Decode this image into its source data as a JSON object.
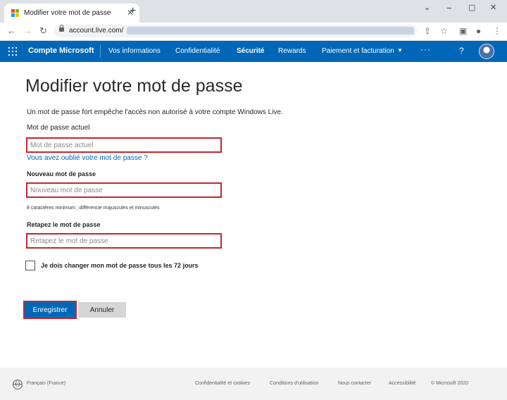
{
  "browser": {
    "tab_title": "Modifier votre mot de passe",
    "tab_close": "✕",
    "new_tab": "+",
    "url": "account.live.com/",
    "win_minimize": "−",
    "win_maximize": "▢",
    "win_close": "✕",
    "win_dropdown": "⌄"
  },
  "header": {
    "brand": "Compte Microsoft",
    "nav": [
      "Vos informations",
      "Confidentialité",
      "Sécurité",
      "Rewards",
      "Paiement et facturation"
    ],
    "active_index": 2,
    "more": "···",
    "help": "?",
    "bg_color": "#0067b8"
  },
  "main": {
    "title": "Modifier votre mot de passe",
    "intro": "Un mot de passe fort empêche l'accès non autorisé à votre compte Windows Live.",
    "current_label": "Mot de passe actuel",
    "current_placeholder": "Mot de passe actuel",
    "forgot_link": "Vous avez oublié votre mot de passe ?",
    "new_label": "Nouveau mot de passe",
    "new_placeholder": "Nouveau mot de passe",
    "hint": "8 caractères minimum ; différencie majuscules et minuscules",
    "retype_label": "Retapez le mot de passe",
    "retype_placeholder": "Retapez le mot de passe",
    "checkbox_label": "Je dois changer mon mot de passe tous les 72 jours",
    "checkbox_checked": false,
    "save_button": "Enregistrer",
    "cancel_button": "Annuler",
    "highlight_color": "#c4262e"
  },
  "footer": {
    "locale": "Français (France)",
    "links": [
      "Confidentialité et cookies",
      "Conditions d'utilisation",
      "Nous contacter",
      "Accessibilité",
      "© Microsoft 2020"
    ]
  }
}
